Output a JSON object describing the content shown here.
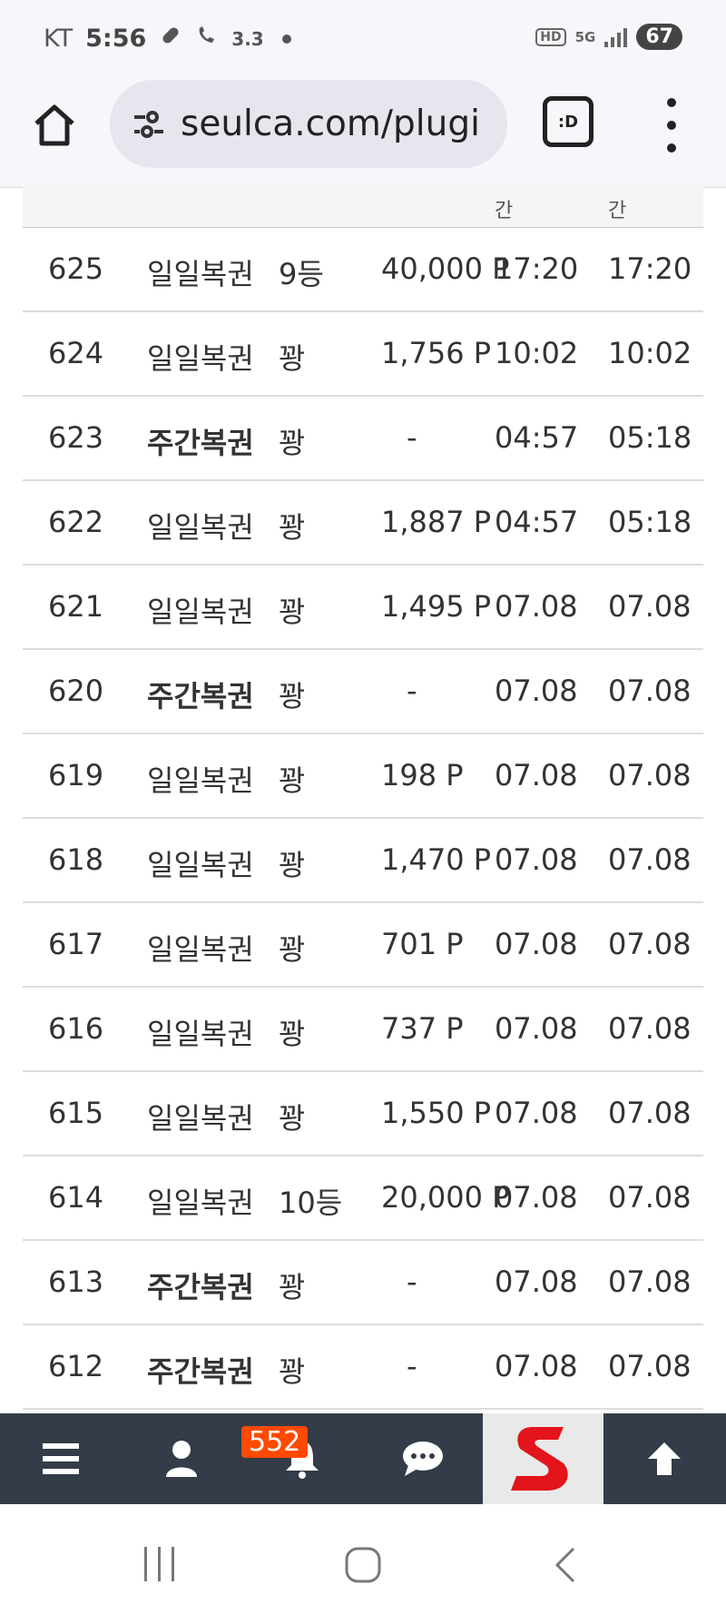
{
  "status_bar": {
    "carrier": "KT",
    "time": "5:56",
    "speed": "3.3",
    "hd": "HD",
    "network": "5G",
    "battery": "67"
  },
  "browser": {
    "url": "seulca.com/plugi"
  },
  "table": {
    "header_fragments": [
      "간",
      "간"
    ],
    "rows": [
      {
        "no": "625",
        "type": "일일복권",
        "bold": false,
        "rank": "9등",
        "prize": "40,000 P",
        "t1": "17:20",
        "t2": "17:20"
      },
      {
        "no": "624",
        "type": "일일복권",
        "bold": false,
        "rank": "꽝",
        "prize": "1,756 P",
        "t1": "10:02",
        "t2": "10:02"
      },
      {
        "no": "623",
        "type": "주간복권",
        "bold": true,
        "rank": "꽝",
        "prize": "-",
        "t1": "04:57",
        "t2": "05:18"
      },
      {
        "no": "622",
        "type": "일일복권",
        "bold": false,
        "rank": "꽝",
        "prize": "1,887 P",
        "t1": "04:57",
        "t2": "05:18"
      },
      {
        "no": "621",
        "type": "일일복권",
        "bold": false,
        "rank": "꽝",
        "prize": "1,495 P",
        "t1": "07.08",
        "t2": "07.08"
      },
      {
        "no": "620",
        "type": "주간복권",
        "bold": true,
        "rank": "꽝",
        "prize": "-",
        "t1": "07.08",
        "t2": "07.08"
      },
      {
        "no": "619",
        "type": "일일복권",
        "bold": false,
        "rank": "꽝",
        "prize": "198 P",
        "t1": "07.08",
        "t2": "07.08"
      },
      {
        "no": "618",
        "type": "일일복권",
        "bold": false,
        "rank": "꽝",
        "prize": "1,470 P",
        "t1": "07.08",
        "t2": "07.08"
      },
      {
        "no": "617",
        "type": "일일복권",
        "bold": false,
        "rank": "꽝",
        "prize": "701 P",
        "t1": "07.08",
        "t2": "07.08"
      },
      {
        "no": "616",
        "type": "일일복권",
        "bold": false,
        "rank": "꽝",
        "prize": "737 P",
        "t1": "07.08",
        "t2": "07.08"
      },
      {
        "no": "615",
        "type": "일일복권",
        "bold": false,
        "rank": "꽝",
        "prize": "1,550 P",
        "t1": "07.08",
        "t2": "07.08"
      },
      {
        "no": "614",
        "type": "일일복권",
        "bold": false,
        "rank": "10등",
        "prize": "20,000 P",
        "t1": "07.08",
        "t2": "07.08"
      },
      {
        "no": "613",
        "type": "주간복권",
        "bold": true,
        "rank": "꽝",
        "prize": "-",
        "t1": "07.08",
        "t2": "07.08"
      },
      {
        "no": "612",
        "type": "주간복권",
        "bold": true,
        "rank": "꽝",
        "prize": "-",
        "t1": "07.08",
        "t2": "07.08"
      }
    ]
  },
  "bottom_nav": {
    "notification_count": "552"
  },
  "colors": {
    "nav_bg": "#333c48",
    "badge": "#ff4a00",
    "logo_red": "#e3141b"
  }
}
